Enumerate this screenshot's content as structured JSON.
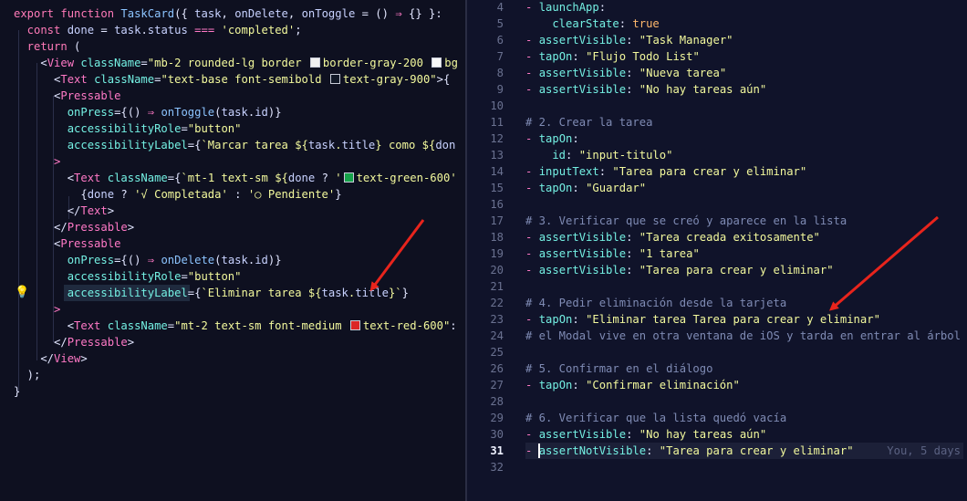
{
  "left_editor": {
    "lines": [
      [
        [
          "kw",
          "export "
        ],
        [
          "kw",
          "function "
        ],
        [
          "fn",
          "TaskCard"
        ],
        [
          "txt",
          "({ "
        ],
        [
          "var",
          "task"
        ],
        [
          "txt",
          ", "
        ],
        [
          "var",
          "onDelete"
        ],
        [
          "txt",
          ", "
        ],
        [
          "var",
          "onToggle"
        ],
        [
          "txt",
          " = () "
        ],
        [
          "op",
          "⇒"
        ],
        [
          "txt",
          " {} }: "
        ]
      ],
      [
        [
          "kw",
          "  const "
        ],
        [
          "var",
          "done"
        ],
        [
          "txt",
          " = "
        ],
        [
          "var",
          "task"
        ],
        [
          "txt",
          "."
        ],
        [
          "var",
          "status"
        ],
        [
          "op",
          " === "
        ],
        [
          "str",
          "'completed'"
        ],
        [
          "txt",
          ";"
        ]
      ],
      [
        [
          "kw",
          "  return "
        ],
        [
          "txt",
          "("
        ]
      ],
      [
        [
          "txt",
          "    <"
        ],
        [
          "tag",
          "View "
        ],
        [
          "attr",
          "className"
        ],
        [
          "txt",
          "="
        ],
        [
          "str",
          "\"mb-2 rounded-lg border "
        ],
        [
          "sw",
          "#f0f0f0"
        ],
        [
          "str",
          "border-gray-200 "
        ],
        [
          "sw",
          "#f7f7f7"
        ],
        [
          "str",
          "bg"
        ]
      ],
      [
        [
          "txt",
          "      <"
        ],
        [
          "tag",
          "Text "
        ],
        [
          "attr",
          "className"
        ],
        [
          "txt",
          "="
        ],
        [
          "str",
          "\"text-base font-semibold "
        ],
        [
          "sw",
          "#111827"
        ],
        [
          "str",
          "text-gray-900\""
        ],
        [
          "txt",
          ">{"
        ]
      ],
      [
        [
          "txt",
          "      <"
        ],
        [
          "tag",
          "Pressable"
        ]
      ],
      [
        [
          "attr",
          "        onPress"
        ],
        [
          "txt",
          "={() "
        ],
        [
          "op",
          "⇒ "
        ],
        [
          "fn",
          "onToggle"
        ],
        [
          "txt",
          "("
        ],
        [
          "var",
          "task"
        ],
        [
          "txt",
          "."
        ],
        [
          "var",
          "id"
        ],
        [
          "txt",
          ")}"
        ]
      ],
      [
        [
          "attr",
          "        accessibilityRole"
        ],
        [
          "txt",
          "="
        ],
        [
          "str",
          "\"button\""
        ]
      ],
      [
        [
          "attr",
          "        accessibilityLabel"
        ],
        [
          "txt",
          "={"
        ],
        [
          "str",
          "`Marcar tarea ${"
        ],
        [
          "var",
          "task"
        ],
        [
          "str",
          "."
        ],
        [
          "var",
          "title"
        ],
        [
          "str",
          "} como ${"
        ],
        [
          "var",
          "don"
        ]
      ],
      [
        [
          "op",
          "      >"
        ]
      ],
      [
        [
          "txt",
          "        <"
        ],
        [
          "tag",
          "Text "
        ],
        [
          "attr",
          "className"
        ],
        [
          "txt",
          "={"
        ],
        [
          "str",
          "`mt-1 text-sm ${"
        ],
        [
          "var",
          "done"
        ],
        [
          "txt",
          " ? "
        ],
        [
          "str",
          "'"
        ],
        [
          "sw",
          "#16a34a"
        ],
        [
          "str",
          "text-green-600'"
        ]
      ],
      [
        [
          "txt",
          "          {"
        ],
        [
          "var",
          "done"
        ],
        [
          "txt",
          " ? "
        ],
        [
          "str",
          "'√ Completada'"
        ],
        [
          "txt",
          " : "
        ],
        [
          "str",
          "'○ Pendiente'"
        ],
        [
          "txt",
          "}"
        ]
      ],
      [
        [
          "txt",
          "        </"
        ],
        [
          "tag",
          "Text"
        ],
        [
          "txt",
          ">"
        ]
      ],
      [
        [
          "txt",
          "      </"
        ],
        [
          "tag",
          "Pressable"
        ],
        [
          "txt",
          ">"
        ]
      ],
      [
        [
          "txt",
          "      <"
        ],
        [
          "tag",
          "Pressable"
        ]
      ],
      [
        [
          "attr",
          "        onPress"
        ],
        [
          "txt",
          "={() "
        ],
        [
          "op",
          "⇒ "
        ],
        [
          "fn",
          "onDelete"
        ],
        [
          "txt",
          "("
        ],
        [
          "var",
          "task"
        ],
        [
          "txt",
          "."
        ],
        [
          "var",
          "id"
        ],
        [
          "txt",
          ")}"
        ]
      ],
      [
        [
          "attr",
          "        accessibilityRole"
        ],
        [
          "txt",
          "="
        ],
        [
          "str",
          "\"button\""
        ]
      ],
      [
        [
          "attr",
          "        accessibilityLabel"
        ],
        [
          "txt",
          "={"
        ],
        [
          "str",
          "`Eliminar tarea ${"
        ],
        [
          "var",
          "task"
        ],
        [
          "str",
          "."
        ],
        [
          "var",
          "title"
        ],
        [
          "str",
          "}`"
        ],
        [
          "txt",
          "}"
        ]
      ],
      [
        [
          "op",
          "      >"
        ]
      ],
      [
        [
          "txt",
          "        <"
        ],
        [
          "tag",
          "Text "
        ],
        [
          "attr",
          "className"
        ],
        [
          "txt",
          "="
        ],
        [
          "str",
          "\"mt-2 text-sm font-medium "
        ],
        [
          "sw",
          "#dc2626"
        ],
        [
          "str",
          "text-red-600\""
        ],
        [
          "txt",
          ":"
        ]
      ],
      [
        [
          "txt",
          "      </"
        ],
        [
          "tag",
          "Pressable"
        ],
        [
          "txt",
          ">"
        ]
      ],
      [
        [
          "txt",
          "    </"
        ],
        [
          "tag",
          "View"
        ],
        [
          "txt",
          ">"
        ]
      ],
      [
        [
          "txt",
          "  );"
        ]
      ],
      [
        [
          "txt",
          "}"
        ]
      ]
    ]
  },
  "right_editor": {
    "line_numbers": [
      "4",
      "5",
      "6",
      "7",
      "8",
      "9",
      "10",
      "11",
      "12",
      "13",
      "14",
      "15",
      "16",
      "17",
      "18",
      "19",
      "20",
      "21",
      "22",
      "23",
      "24",
      "25",
      "26",
      "27",
      "28",
      "29",
      "30",
      "31",
      "32"
    ],
    "active_line": "31",
    "lines": [
      [
        [
          "ydash",
          "- "
        ],
        [
          "ykey",
          "launchApp"
        ],
        [
          "txt",
          ":"
        ]
      ],
      [
        [
          "ykey",
          "    clearState"
        ],
        [
          "txt",
          ": "
        ],
        [
          "bool",
          "true"
        ]
      ],
      [
        [
          "ydash",
          "- "
        ],
        [
          "ykey",
          "assertVisible"
        ],
        [
          "txt",
          ": "
        ],
        [
          "yval",
          "\"Task Manager\""
        ]
      ],
      [
        [
          "ydash",
          "- "
        ],
        [
          "ykey",
          "tapOn"
        ],
        [
          "txt",
          ": "
        ],
        [
          "yval",
          "\"Flujo Todo List\""
        ]
      ],
      [
        [
          "ydash",
          "- "
        ],
        [
          "ykey",
          "assertVisible"
        ],
        [
          "txt",
          ": "
        ],
        [
          "yval",
          "\"Nueva tarea\""
        ]
      ],
      [
        [
          "ydash",
          "- "
        ],
        [
          "ykey",
          "assertVisible"
        ],
        [
          "txt",
          ": "
        ],
        [
          "yval",
          "\"No hay tareas aún\""
        ]
      ],
      [],
      [
        [
          "cmt",
          "# 2. Crear la tarea"
        ]
      ],
      [
        [
          "ydash",
          "- "
        ],
        [
          "ykey",
          "tapOn"
        ],
        [
          "txt",
          ":"
        ]
      ],
      [
        [
          "ykey",
          "    id"
        ],
        [
          "txt",
          ": "
        ],
        [
          "yval",
          "\"input-titulo\""
        ]
      ],
      [
        [
          "ydash",
          "- "
        ],
        [
          "ykey",
          "inputText"
        ],
        [
          "txt",
          ": "
        ],
        [
          "yval",
          "\"Tarea para crear y eliminar\""
        ]
      ],
      [
        [
          "ydash",
          "- "
        ],
        [
          "ykey",
          "tapOn"
        ],
        [
          "txt",
          ": "
        ],
        [
          "yval",
          "\"Guardar\""
        ]
      ],
      [],
      [
        [
          "cmt",
          "# 3. Verificar que se creó y aparece en la lista"
        ]
      ],
      [
        [
          "ydash",
          "- "
        ],
        [
          "ykey",
          "assertVisible"
        ],
        [
          "txt",
          ": "
        ],
        [
          "yval",
          "\"Tarea creada exitosamente\""
        ]
      ],
      [
        [
          "ydash",
          "- "
        ],
        [
          "ykey",
          "assertVisible"
        ],
        [
          "txt",
          ": "
        ],
        [
          "yval",
          "\"1 tarea\""
        ]
      ],
      [
        [
          "ydash",
          "- "
        ],
        [
          "ykey",
          "assertVisible"
        ],
        [
          "txt",
          ": "
        ],
        [
          "yval",
          "\"Tarea para crear y eliminar\""
        ]
      ],
      [],
      [
        [
          "cmt",
          "# 4. Pedir eliminación desde la tarjeta"
        ]
      ],
      [
        [
          "ydash",
          "- "
        ],
        [
          "ykey",
          "tapOn"
        ],
        [
          "txt",
          ": "
        ],
        [
          "yval",
          "\"Eliminar tarea Tarea para crear y eliminar\""
        ]
      ],
      [
        [
          "cmt",
          "# el Modal vive en otra ventana de iOS y tarda en entrar al árbol"
        ]
      ],
      [],
      [
        [
          "cmt",
          "# 5. Confirmar en el diálogo"
        ]
      ],
      [
        [
          "ydash",
          "- "
        ],
        [
          "ykey",
          "tapOn"
        ],
        [
          "txt",
          ": "
        ],
        [
          "yval",
          "\"Confirmar eliminación\""
        ]
      ],
      [],
      [
        [
          "cmt",
          "# 6. Verificar que la lista quedó vacía"
        ]
      ],
      [
        [
          "ydash",
          "- "
        ],
        [
          "ykey",
          "assertVisible"
        ],
        [
          "txt",
          ": "
        ],
        [
          "yval",
          "\"No hay tareas aún\""
        ]
      ],
      [
        [
          "ydash",
          "- "
        ],
        [
          "ykey",
          "assertNotVisible"
        ],
        [
          "txt",
          ": "
        ],
        [
          "yval",
          "\"Tarea para crear y eliminar\""
        ],
        [
          "blame",
          "     You, 5 days"
        ]
      ],
      []
    ]
  },
  "colors": {
    "arrow": "#e8241c"
  }
}
